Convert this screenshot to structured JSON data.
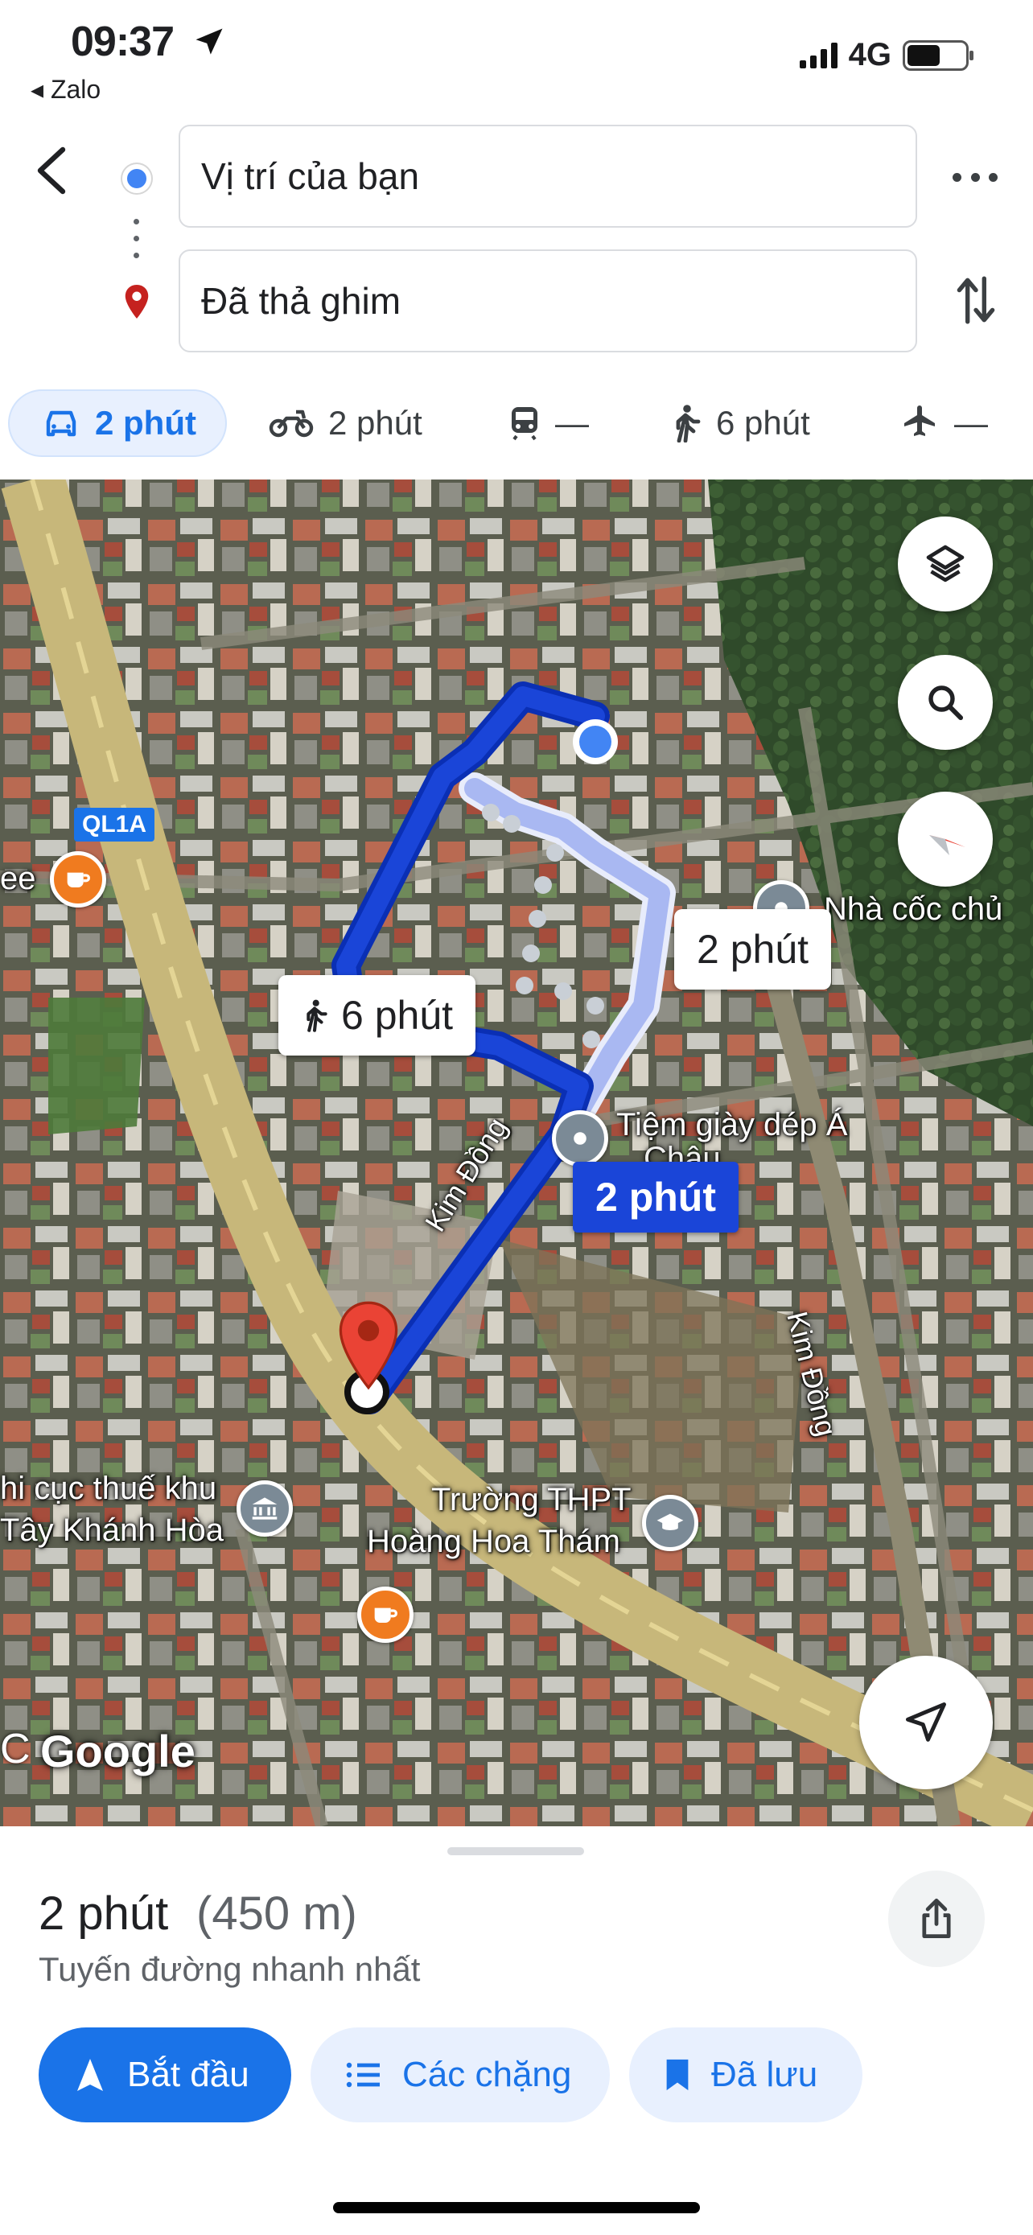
{
  "status_bar": {
    "time": "09:37",
    "back_app": "Zalo",
    "network": "4G"
  },
  "route": {
    "origin": "Vị trí của bạn",
    "destination": "Đã thả ghim"
  },
  "modes": [
    {
      "icon": "car-icon",
      "label": "2 phút",
      "active": true
    },
    {
      "icon": "motorbike-icon",
      "label": "2 phút",
      "active": false
    },
    {
      "icon": "transit-icon",
      "label": "—",
      "active": false
    },
    {
      "icon": "walk-icon",
      "label": "6 phút",
      "active": false
    },
    {
      "icon": "flight-icon",
      "label": "—",
      "active": false
    }
  ],
  "map": {
    "road_badge": "QL1A",
    "labels": {
      "cafe_partial": "ee",
      "nha_coc": "Nhà cốc chủ",
      "tiem_giay": "Tiệm giày dép Á",
      "tiem_giay_line2": "Châu",
      "kim_dong_1": "Kim Đồng",
      "kim_dong_2": "Kim Đồng",
      "tax_office_1": "hi cục thuế khu",
      "tax_office_2": "Tây Khánh Hòa",
      "school_1": "Trường THPT",
      "school_2": "Hoàng Hoa Thám",
      "google": "Google",
      "edge_c": "C"
    },
    "callouts": {
      "walk": "6 phút",
      "alt_route": "2 phút",
      "main_route": "2 phút"
    }
  },
  "summary": {
    "time": "2 phút",
    "distance": "(450 m)",
    "subtitle": "Tuyến đường nhanh nhất"
  },
  "actions": {
    "start": "Bắt đầu",
    "steps": "Các chặng",
    "saved": "Đã lưu"
  },
  "colors": {
    "accent": "#1a73e8",
    "route": "#1a45d8",
    "alt_route": "#a9b8f2",
    "pin": "#ea4335"
  }
}
